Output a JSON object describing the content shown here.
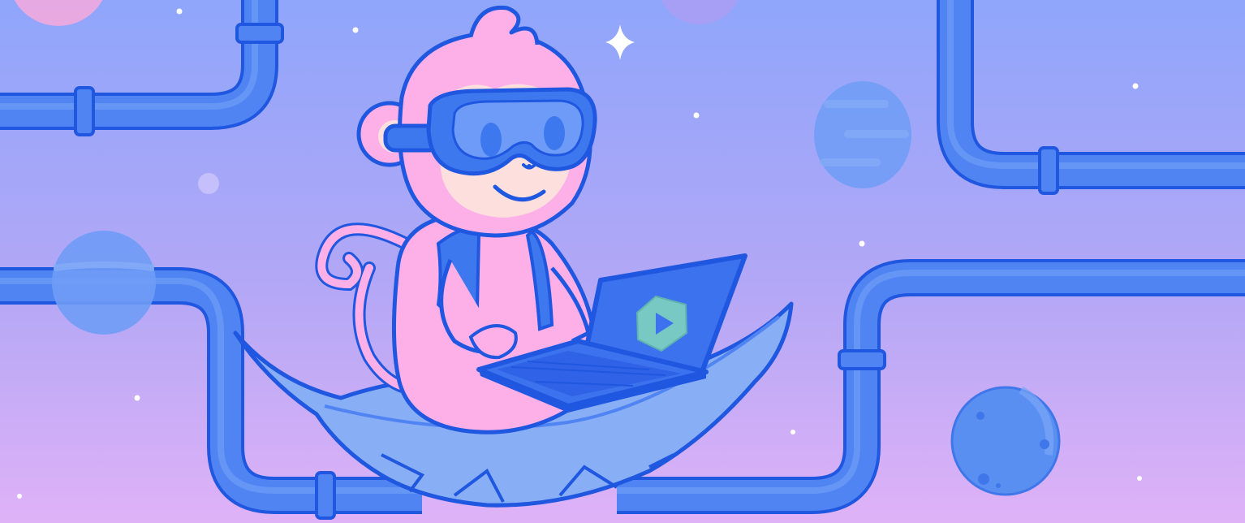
{
  "scene": {
    "subject": "pink-monkey-with-vr-goggles-typing-on-laptop-riding-leaf",
    "icons": [
      "monkey",
      "vr-goggles",
      "laptop",
      "play-logo",
      "leaf",
      "pipes",
      "planets",
      "stars",
      "sparkle"
    ],
    "colors": {
      "sky_top": "#8fa6fb",
      "sky_mid": "#b3a7f6",
      "sky_bottom": "#dfb2f7",
      "pipe_fill": "#4f84f2",
      "pipe_light": "#6f9cf6",
      "outline": "#1f57e0",
      "monkey_pink": "#fdb0e8",
      "monkey_face": "#fde0dd",
      "goggle_blue": "#3e78ee",
      "goggle_lens": "#6d9bf7",
      "laptop_blue": "#3d72ee",
      "laptop_screen": "#2f62e6",
      "logo_green": "#78c8c4",
      "leaf_blue": "#88aef6",
      "planet_blue": "#6f9cf6",
      "planet_pink": "#fdb0e8",
      "star_white": "#ffffff"
    }
  }
}
